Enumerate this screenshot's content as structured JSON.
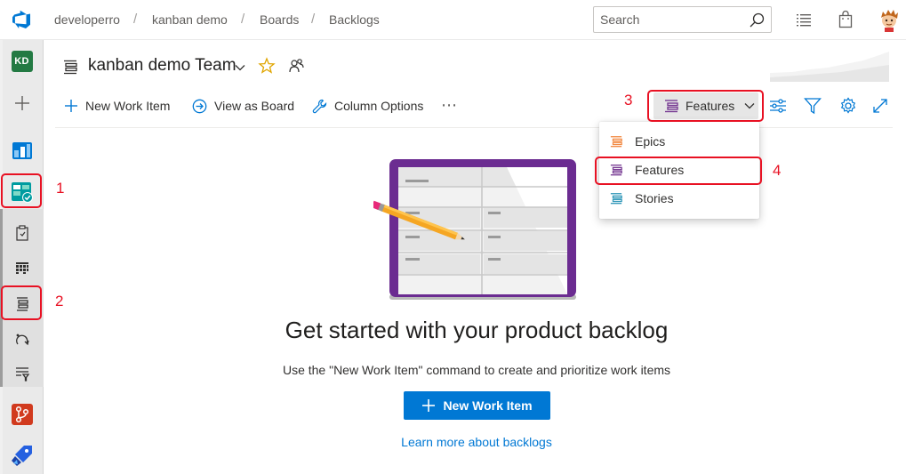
{
  "breadcrumb": {
    "items": [
      "developerro",
      "kanban demo",
      "Boards",
      "Backlogs"
    ],
    "separator": "/"
  },
  "search": {
    "placeholder": "Search"
  },
  "left_nav": {
    "user_initials": "KD",
    "items": [
      "plus-icon",
      "overview-icon",
      "boards-icon",
      "work-items-icon",
      "boards-grid-icon",
      "backlogs-icon",
      "sprints-icon",
      "queries-icon",
      "repos-icon",
      "pipelines-icon"
    ]
  },
  "header": {
    "team_name": "kanban demo Team"
  },
  "commands": {
    "new_work_item": "New Work Item",
    "view_as_board": "View as Board",
    "column_options": "Column Options",
    "more": "⋯"
  },
  "backlog_level": {
    "selected": "Features",
    "options": [
      {
        "label": "Epics",
        "color": "#f28b45"
      },
      {
        "label": "Features",
        "color": "#773b93"
      },
      {
        "label": "Stories",
        "color": "#2f97b8"
      }
    ]
  },
  "annotations": [
    "1",
    "2",
    "3",
    "4"
  ],
  "empty_state": {
    "title": "Get started with your product backlog",
    "subtitle": "Use the \"New Work Item\" command to create and prioritize work items",
    "button_label": "New Work Item",
    "link_label": "Learn more about backlogs"
  },
  "colors": {
    "accent_blue": "#0078d4",
    "annotation_red": "#e81123",
    "board_purple": "#6b2c91"
  }
}
